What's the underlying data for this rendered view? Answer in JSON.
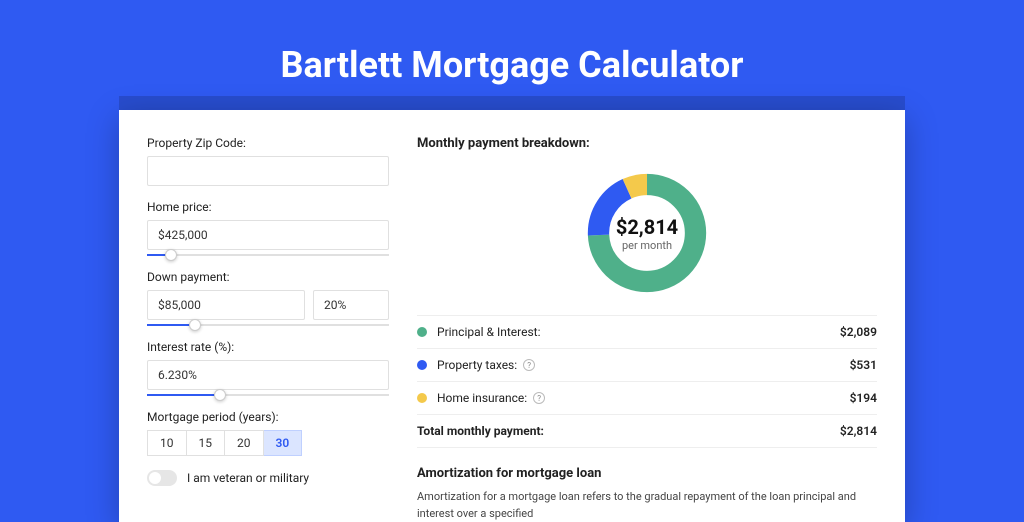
{
  "title": "Bartlett Mortgage Calculator",
  "form": {
    "zip_label": "Property Zip Code:",
    "zip_value": "",
    "home_price_label": "Home price:",
    "home_price_value": "$425,000",
    "home_price_slider_pct": 10,
    "down_label": "Down payment:",
    "down_value": "$85,000",
    "down_pct": "20%",
    "down_slider_pct": 20,
    "rate_label": "Interest rate (%):",
    "rate_value": "6.230%",
    "rate_slider_pct": 30,
    "period_label": "Mortgage period (years):",
    "periods": [
      "10",
      "15",
      "20",
      "30"
    ],
    "period_active": "30",
    "veteran_label": "I am veteran or military"
  },
  "breakdown": {
    "title": "Monthly payment breakdown:",
    "center_value": "$2,814",
    "center_sub": "per month",
    "rows": [
      {
        "color": "#4fb08a",
        "label": "Principal & Interest:",
        "value": "$2,089",
        "info": false
      },
      {
        "color": "#2f5af2",
        "label": "Property taxes:",
        "value": "$531",
        "info": true
      },
      {
        "color": "#f4c94b",
        "label": "Home insurance:",
        "value": "$194",
        "info": true
      }
    ],
    "total_label": "Total monthly payment:",
    "total_value": "$2,814"
  },
  "amort": {
    "title": "Amortization for mortgage loan",
    "text": "Amortization for a mortgage loan refers to the gradual repayment of the loan principal and interest over a specified"
  },
  "chart_data": {
    "type": "pie",
    "title": "Monthly payment breakdown",
    "series": [
      {
        "name": "Principal & Interest",
        "value": 2089,
        "color": "#4fb08a"
      },
      {
        "name": "Property taxes",
        "value": 531,
        "color": "#2f5af2"
      },
      {
        "name": "Home insurance",
        "value": 194,
        "color": "#f4c94b"
      }
    ],
    "total": 2814
  }
}
